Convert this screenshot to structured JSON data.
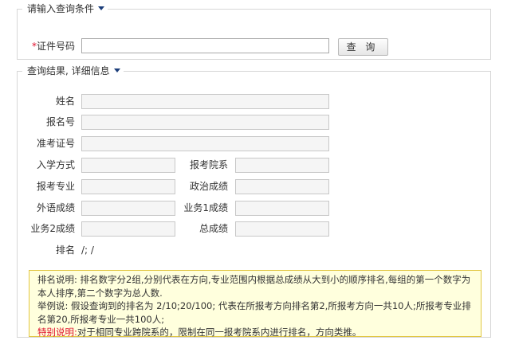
{
  "query": {
    "legend": "请输入查询条件",
    "id_label": "证件号码",
    "required_mark": "*",
    "id_value": "",
    "search_button": "查 询"
  },
  "result": {
    "legend": "查询结果, 详细信息",
    "fields": {
      "name": {
        "label": "姓名",
        "value": ""
      },
      "reg_no": {
        "label": "报名号",
        "value": ""
      },
      "admission_no": {
        "label": "准考证号",
        "value": ""
      },
      "entry_method": {
        "label": "入学方式",
        "value": ""
      },
      "department": {
        "label": "报考院系",
        "value": ""
      },
      "major": {
        "label": "报考专业",
        "value": ""
      },
      "politics": {
        "label": "政治成绩",
        "value": ""
      },
      "foreign_lang": {
        "label": "外语成绩",
        "value": ""
      },
      "subject1": {
        "label": "业务1成绩",
        "value": ""
      },
      "subject2": {
        "label": "业务2成绩",
        "value": ""
      },
      "total": {
        "label": "总成绩",
        "value": ""
      }
    },
    "rank": {
      "label": "排名",
      "value": "/; /"
    }
  },
  "note": {
    "line1": "排名说明: 排名数字分2组,分别代表在方向,专业范围内根据总成绩从大到小的顺序排名,每组的第一个数字为本人排序,第二个数字为总人数.",
    "line2": "举例说: 假设查询到的排名为 2/10;20/100; 代表在所报考方向排名第2,所报考方向一共10人;所报考专业排名第20,所报考专业一共100人;",
    "special_label": "特别说明:",
    "special_text": "对于相同专业跨院系的，限制在同一报考院系内进行排名，方向类推。"
  }
}
